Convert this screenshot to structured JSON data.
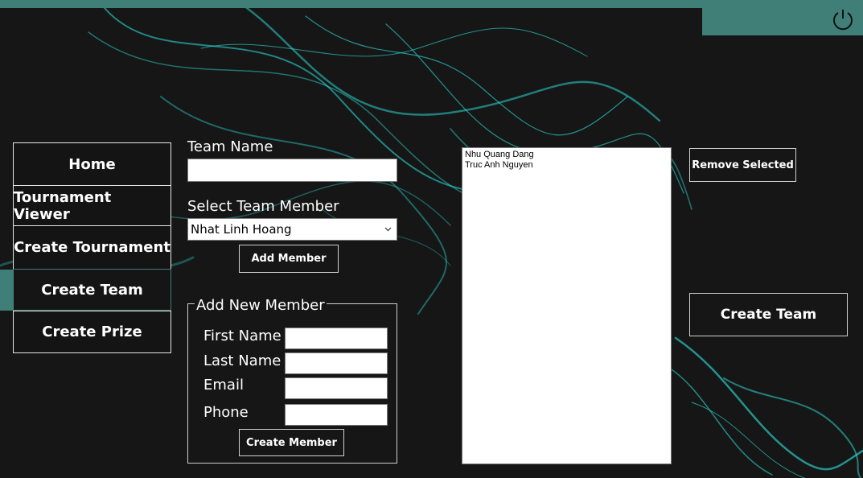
{
  "nav": {
    "items": [
      {
        "label": "Home"
      },
      {
        "label": "Tournament Viewer"
      },
      {
        "label": "Create Tournament"
      },
      {
        "label": "Create Team"
      },
      {
        "label": "Create Prize"
      }
    ],
    "active": "Create Team"
  },
  "form": {
    "team_name_label": "Team Name",
    "team_name_value": "",
    "select_member_label": "Select Team Member",
    "select_member_value": "Nhat Linh Hoang",
    "add_member_button": "Add Member"
  },
  "new_member": {
    "legend": "Add New Member",
    "first_name_label": "First Name",
    "last_name_label": "Last Name",
    "email_label": "Email",
    "phone_label": "Phone",
    "create_member_button": "Create Member"
  },
  "team_members": [
    "Nhu Quang Dang",
    "Truc Anh Nguyen"
  ],
  "actions": {
    "remove_selected_button": "Remove Selected",
    "create_team_button": "Create Team"
  },
  "icons": {
    "power": "power-icon",
    "dropdown": "chevron-down-icon"
  },
  "colors": {
    "accent": "#3f7f78",
    "background": "#161616",
    "smoke": "#2ee6e0"
  }
}
